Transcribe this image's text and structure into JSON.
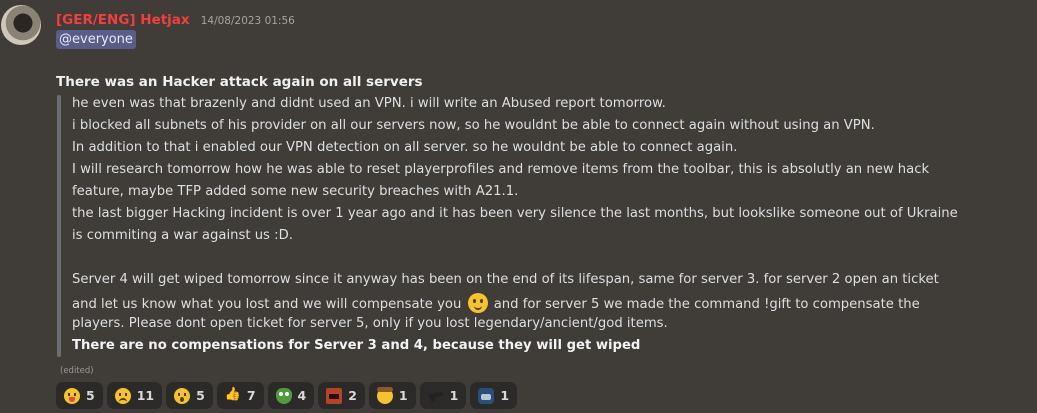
{
  "message": {
    "username": "[GER/ENG] Hetjax",
    "timestamp": "14/08/2023 01:56",
    "mention": "@everyone",
    "heading": "There was an Hacker attack again on all servers",
    "quote_lines": [
      "he even was that brazenly and didnt used an VPN. i will write an Abused report tomorrow.",
      "i blocked all subnets of his provider on all our servers now, so he wouldnt be able to connect again without using an VPN.",
      "In addition to that i enabled our VPN detection on all server. so he wouldnt be able to connect again.",
      "I will research tomorrow how he was able to reset playerprofiles and remove items from the toolbar, this is absolutly an new hack",
      "feature, maybe TFP added some new security breaches with A21.1.",
      "the last bigger Hacking incident is over 1 year ago and it has been very silence the last months, but lookslike someone out of Ukraine",
      "is commiting a war against us :D.",
      "",
      "Server 4 will get wiped tomorrow since it anyway has been on the end of its lifespan, same for server 3. for server 2  open an ticket",
      "and let us know what you lost and we will compensate you",
      "and for server 5 we made the command !gift to compensate the",
      "players. Please dont open ticket for server 5, only if you lost legendary/ancient/god items.",
      "There are no compensations for Server 3 and 4, because they will get wiped"
    ],
    "edited_label": "(edited)",
    "username_color": "#f23f43"
  },
  "reactions": [
    {
      "emoji": "tongue-face-icon",
      "count": "5"
    },
    {
      "emoji": "sad-face-icon",
      "count": "11"
    },
    {
      "emoji": "surprised-face-icon",
      "count": "5"
    },
    {
      "emoji": "thumbs-up-icon",
      "count": "7"
    },
    {
      "emoji": "pepe-icon",
      "count": "4"
    },
    {
      "emoji": "angry-square-icon",
      "count": "2"
    },
    {
      "emoji": "cowboy-face-icon",
      "count": "1"
    },
    {
      "emoji": "gun-icon",
      "count": "1"
    },
    {
      "emoji": "cat-icon",
      "count": "1"
    }
  ]
}
